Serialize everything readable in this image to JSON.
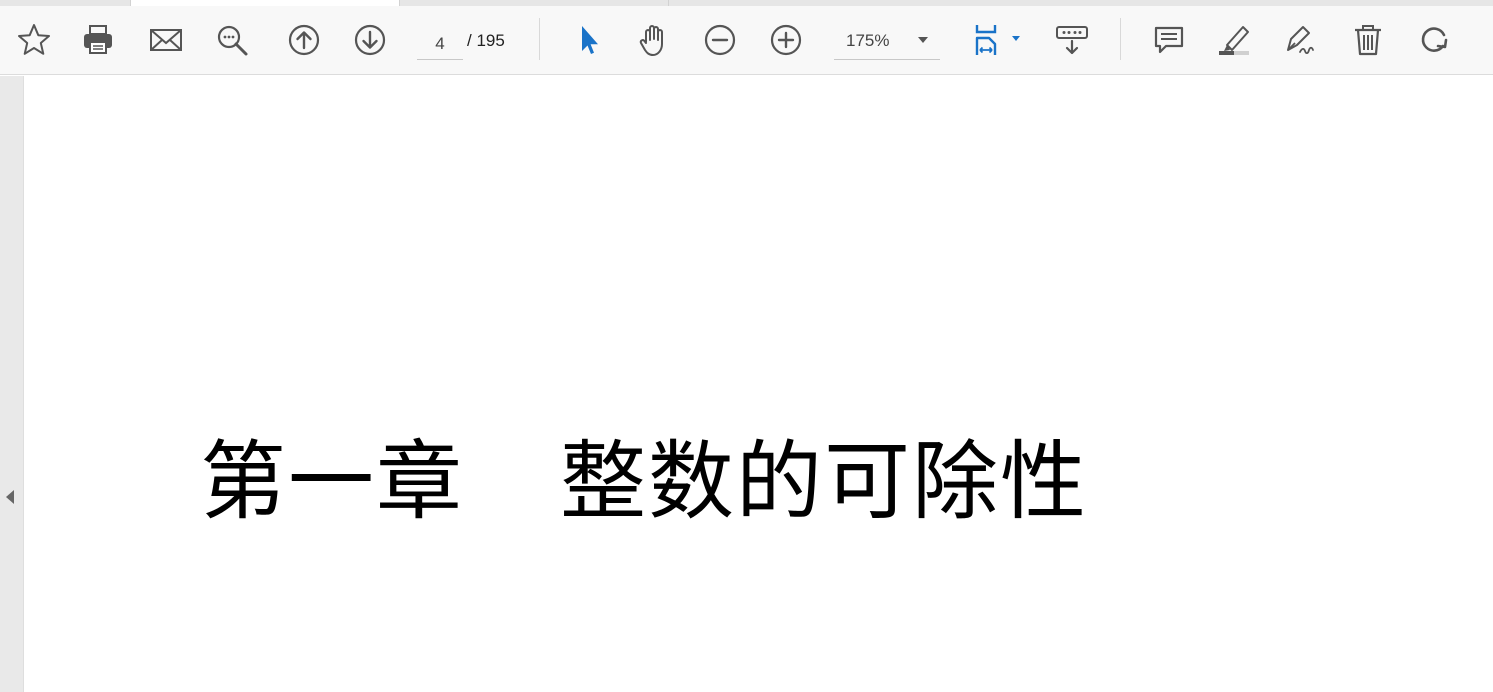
{
  "toolbar": {
    "page_current": "4",
    "page_total": "/ 195",
    "zoom": "175%",
    "icons": {
      "bookmark": "star-icon",
      "print": "printer-icon",
      "email": "envelope-icon",
      "find": "search-icon",
      "prev_page": "arrow-up-circle-icon",
      "next_page": "arrow-down-circle-icon",
      "select": "cursor-icon",
      "pan": "hand-icon",
      "zoom_out": "minus-circle-icon",
      "zoom_in": "plus-circle-icon",
      "fit": "page-fit-icon",
      "scroll_mode": "scroll-mode-icon",
      "comment": "comment-icon",
      "highlight": "highlighter-icon",
      "sign": "pen-nib-icon",
      "delete": "trash-icon",
      "rotate": "rotate-icon"
    },
    "accent_color": "#1a73c8"
  },
  "document": {
    "chapter_label": "第一章",
    "chapter_title": "整数的可除性"
  }
}
